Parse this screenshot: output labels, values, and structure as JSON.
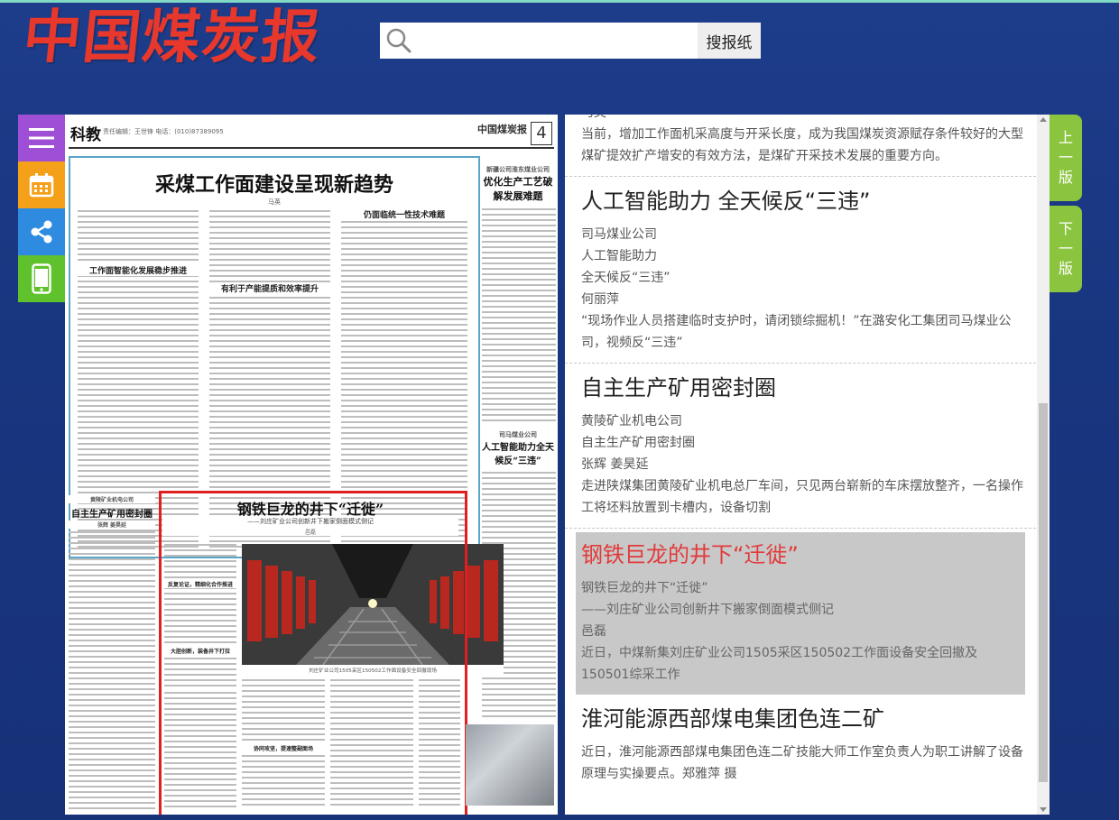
{
  "brand": {
    "logo_text": "中国煤炭报"
  },
  "search": {
    "placeholder": "",
    "button_label": "搜报纸"
  },
  "sidebar": {
    "items": [
      {
        "name": "menu",
        "icon": "menu-icon"
      },
      {
        "name": "calendar",
        "icon": "calendar-icon"
      },
      {
        "name": "share",
        "icon": "share-icon"
      },
      {
        "name": "mobile",
        "icon": "mobile-icon"
      }
    ]
  },
  "paper": {
    "section": "科教",
    "meta": "责任编辑：王世锋  电话：(010)87389095",
    "masthead": "中国煤炭报",
    "page_no": "4",
    "main_headline": "采煤工作面建设呈现新趋势",
    "main_byline": "马英",
    "sub_head_1": "工作面智能化发展稳步推进",
    "sub_head_2": "有利于产能提质和效率提升",
    "sub_head_3": "仍面临统一性技术难题",
    "right_col_org": "新疆公司淮东煤业公司",
    "right_col_title": "优化生产工艺破解发展难题",
    "right_col_title_2": "人工智能助力全天候反“三违”",
    "right_col_org_2": "司马煤业公司",
    "left_bottom_org": "黄陵矿业机电公司",
    "left_bottom_title": "自主生产矿用密封圈",
    "left_bottom_byline": "张辉  姜昊延",
    "feature_headline": "钢铁巨龙的井下“迁徙”",
    "feature_sub": "——刘庄矿业公司创新井下搬家倒面模式侧记",
    "feature_author": "邑磊",
    "feature_caption": "刘庄矿业公司1505采区150502工作面设备安全回撤现场",
    "feature_sub_head_1": "反复论证，精细化合作推进",
    "feature_sub_head_2": "大胆创新，装备井下打拉",
    "feature_sub_head_3": "协同攻坚，提速整副面场"
  },
  "articles": [
    {
      "title": "",
      "lines": [
        "马英",
        "当前，增加工作面机采高度与开采长度，成为我国煤炭资源赋存条件较好的大型煤矿提效扩产增安的有效方法，是煤矿开采技术发展的重要方向。"
      ]
    },
    {
      "title": "人工智能助力 全天候反“三违”",
      "lines": [
        "司马煤业公司",
        "人工智能助力",
        "全天候反“三违”",
        "何丽萍",
        "“现场作业人员搭建临时支护时，请闭锁综掘机！”在潞安化工集团司马煤业公司，视频反“三违”"
      ]
    },
    {
      "title": "自主生产矿用密封圈",
      "lines": [
        "黄陵矿业机电公司",
        "自主生产矿用密封圈",
        "张辉 姜昊延",
        "走进陕煤集团黄陵矿业机电总厂车间，只见两台崭新的车床摆放整齐，一名操作工将坯料放置到卡槽内，设备切割"
      ]
    },
    {
      "title": "钢铁巨龙的井下“迁徙”",
      "active": true,
      "lines": [
        "钢铁巨龙的井下“迁徙”",
        "——刘庄矿业公司创新井下搬家倒面模式侧记",
        "邑磊",
        "近日，中煤新集刘庄矿业公司1505采区150502工作面设备安全回撤及150501综采工作"
      ]
    },
    {
      "title": "淮河能源西部煤电集团色连二矿",
      "lines": [
        "近日，淮河能源西部煤电集团色连二矿技能大师工作室负责人为职工讲解了设备原理与实操要点。郑雅萍 摄"
      ]
    }
  ],
  "edition_nav": {
    "prev_label": [
      "上",
      "一",
      "版"
    ],
    "next_label": [
      "下",
      "一",
      "版"
    ]
  },
  "colors": {
    "background": "#1d3c8a",
    "logo": "#e8382c",
    "active_title": "#e23a3a",
    "edition_button": "#8bc53f",
    "highlight_frame": "#e02020"
  }
}
